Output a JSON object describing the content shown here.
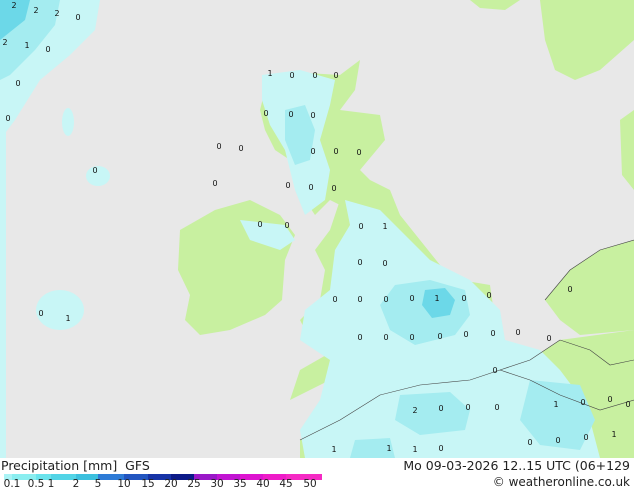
{
  "title": "Precipitation [mm]",
  "model": "GFS",
  "datetime": "Mo 09-03-2026 12..15 UTC (06+129",
  "credit": "© weatheronline.co.uk",
  "legend": {
    "ticks": [
      "0.1",
      "0.5",
      "1",
      "2",
      "5",
      "10",
      "15",
      "20",
      "25",
      "30",
      "35",
      "40",
      "45",
      "50"
    ],
    "colors": [
      "#aaf3f5",
      "#8aeef0",
      "#6ae3ec",
      "#52d4e6",
      "#3cc0de",
      "#2e7bd6",
      "#2255c0",
      "#1733a6",
      "#0c1a88",
      "#9a18c8",
      "#c114d2",
      "#dd14d0",
      "#ee1cc8",
      "#f52ac4"
    ]
  },
  "colors": {
    "sea": "#e8e8e8",
    "land": "#c8f0a0",
    "precip_light": "#c8f6f6",
    "precip_mid": "#a4ecf0",
    "precip_heavy": "#6cd8e8"
  },
  "point_values": [
    "2",
    "2",
    "2",
    "0",
    "2",
    "1",
    "0",
    "0",
    "0",
    "1",
    "0",
    "0",
    "0",
    "0",
    "0",
    "0",
    "0",
    "0",
    "0",
    "0",
    "0",
    "0",
    "0",
    "0",
    "0",
    "0",
    "0",
    "0",
    "0",
    "1",
    "0",
    "0",
    "0",
    "0",
    "0",
    "0",
    "0",
    "0",
    "0",
    "1",
    "1",
    "0",
    "0",
    "0",
    "0",
    "0",
    "0",
    "0",
    "0",
    "0",
    "0",
    "2",
    "0",
    "0",
    "0",
    "1",
    "0",
    "0",
    "1",
    "1",
    "1",
    "0",
    "0",
    "0",
    "0",
    "1",
    "0"
  ]
}
